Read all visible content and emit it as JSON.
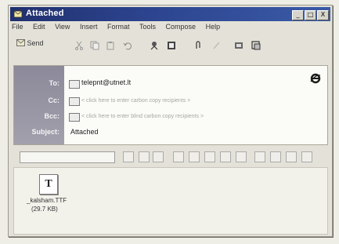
{
  "window": {
    "title": "Attached",
    "controls": [
      "_",
      "□",
      "X"
    ]
  },
  "menu": [
    "File",
    "Edit",
    "View",
    "Insert",
    "Format",
    "Tools",
    "Compose",
    "Help"
  ],
  "toolbar": {
    "send_label": "Send",
    "icons": [
      "cut-icon",
      "copy-icon",
      "paste-icon",
      "undo-icon",
      "check-names-icon",
      "address-book-icon",
      "attach-icon",
      "sign-icon",
      "encrypt-icon",
      "offline-icon"
    ]
  },
  "headers": {
    "to_label": "To:",
    "to_value": "telepnt@utnet.lt",
    "cc_label": "Cc:",
    "cc_placeholder": "< click here to enter carbon copy recipients >",
    "bcc_label": "Bcc:",
    "bcc_placeholder": "< click here to enter blind carbon copy recipients >",
    "subject_label": "Subject:",
    "subject_value": "Attached"
  },
  "attachment": {
    "icon_letter": "T",
    "filename": "_kalsham.TTF",
    "size": "(29.7 KB)"
  },
  "colors": {
    "title_bar": "#2d4590",
    "header_label_bg": "#9895a4",
    "window_bg": "#e4e2d8"
  }
}
